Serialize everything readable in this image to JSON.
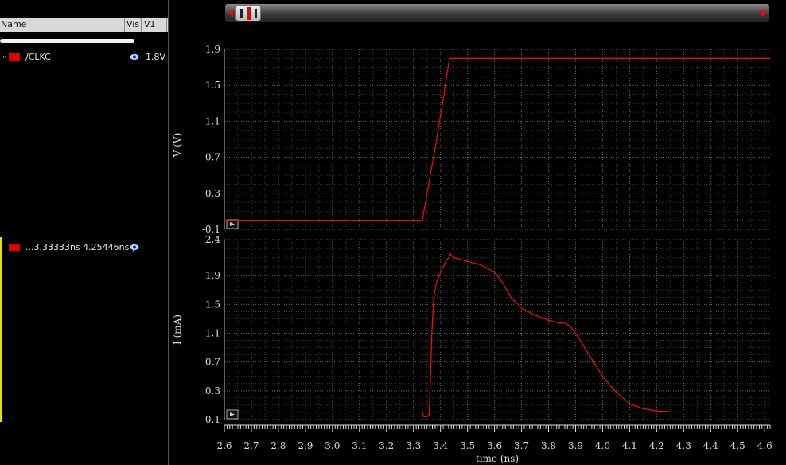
{
  "left_panel": {
    "columns": {
      "name": "Name",
      "vis": "Vis",
      "v1": "V1"
    },
    "signals": [
      {
        "name": "/CLKC",
        "value": "1.8V",
        "color": "#e00000",
        "icon": "eye-icon"
      },
      {
        "name": "...3.33333ns 4.25446ns )",
        "value": "",
        "color": "#e00000",
        "icon": "eye-icon"
      }
    ]
  },
  "chart_data": [
    {
      "type": "line",
      "title": "",
      "xlabel": "time (ns)",
      "ylabel": "V (V)",
      "xlim": [
        2.6,
        4.62
      ],
      "ylim": [
        -0.1,
        1.9
      ],
      "xticks": [
        2.6,
        2.7,
        2.8,
        2.9,
        3.0,
        3.1,
        3.2,
        3.3,
        3.4,
        3.5,
        3.6,
        3.7,
        3.8,
        3.9,
        4.0,
        4.1,
        4.2,
        4.3,
        4.4,
        4.5,
        4.6
      ],
      "xtick_labels": [
        "2.6",
        "2.7",
        "2.8",
        "2.9",
        "3.0",
        "3.1",
        "3.2",
        "3.3",
        "3.4",
        "3.5",
        "3.6",
        "3.7",
        "3.8",
        "3.9",
        "4.0",
        "4.1",
        "4.2",
        "4.3",
        "4.4",
        "4.5",
        "4.6"
      ],
      "yticks": [
        -0.1,
        0.3,
        0.7,
        1.1,
        1.5,
        1.9
      ],
      "ytick_labels": [
        "-0.1",
        "0.3",
        "0.7",
        "1.1",
        "1.5",
        "1.9"
      ],
      "grid": true,
      "series": [
        {
          "name": "/CLKC",
          "color": "#e01010",
          "x": [
            2.6,
            3.333,
            3.35,
            3.38,
            3.41,
            3.433,
            4.62
          ],
          "y": [
            0.0,
            0.0,
            0.3,
            0.8,
            1.35,
            1.8,
            1.8
          ]
        }
      ]
    },
    {
      "type": "line",
      "title": "",
      "xlabel": "time (ns)",
      "ylabel": "I (mA)",
      "xlim": [
        2.6,
        4.62
      ],
      "ylim": [
        -0.1,
        2.4
      ],
      "xticks": [
        2.6,
        2.7,
        2.8,
        2.9,
        3.0,
        3.1,
        3.2,
        3.3,
        3.4,
        3.5,
        3.6,
        3.7,
        3.8,
        3.9,
        4.0,
        4.1,
        4.2,
        4.3,
        4.4,
        4.5,
        4.6
      ],
      "xtick_labels": [
        "2.6",
        "2.7",
        "2.8",
        "2.9",
        "3.0",
        "3.1",
        "3.2",
        "3.3",
        "3.4",
        "3.5",
        "3.6",
        "3.7",
        "3.8",
        "3.9",
        "4.0",
        "4.1",
        "4.2",
        "4.3",
        "4.4",
        "4.5",
        "4.6"
      ],
      "yticks": [
        -0.1,
        0.3,
        0.7,
        1.1,
        1.5,
        1.9,
        2.4
      ],
      "ytick_labels": [
        "-0.1",
        "0.3",
        "0.7",
        "1.1",
        "1.5",
        "1.9",
        "2.4"
      ],
      "grid": true,
      "series": [
        {
          "name": "...3.33333ns 4.25446ns )",
          "color": "#e01010",
          "x": [
            3.333,
            3.338,
            3.35,
            3.358,
            3.363,
            3.368,
            3.375,
            3.385,
            3.4,
            3.42,
            3.43,
            3.435,
            3.45,
            3.5,
            3.55,
            3.6,
            3.63,
            3.66,
            3.7,
            3.75,
            3.8,
            3.83,
            3.86,
            3.88,
            3.9,
            3.95,
            4.0,
            4.05,
            4.1,
            4.15,
            4.2,
            4.25446
          ],
          "y": [
            0.0,
            -0.06,
            -0.06,
            -0.03,
            0.5,
            1.1,
            1.6,
            1.8,
            1.95,
            2.1,
            2.15,
            2.2,
            2.15,
            2.1,
            2.05,
            1.95,
            1.8,
            1.6,
            1.45,
            1.35,
            1.28,
            1.25,
            1.24,
            1.2,
            1.1,
            0.8,
            0.5,
            0.28,
            0.12,
            0.05,
            0.02,
            0.01
          ]
        }
      ]
    }
  ]
}
